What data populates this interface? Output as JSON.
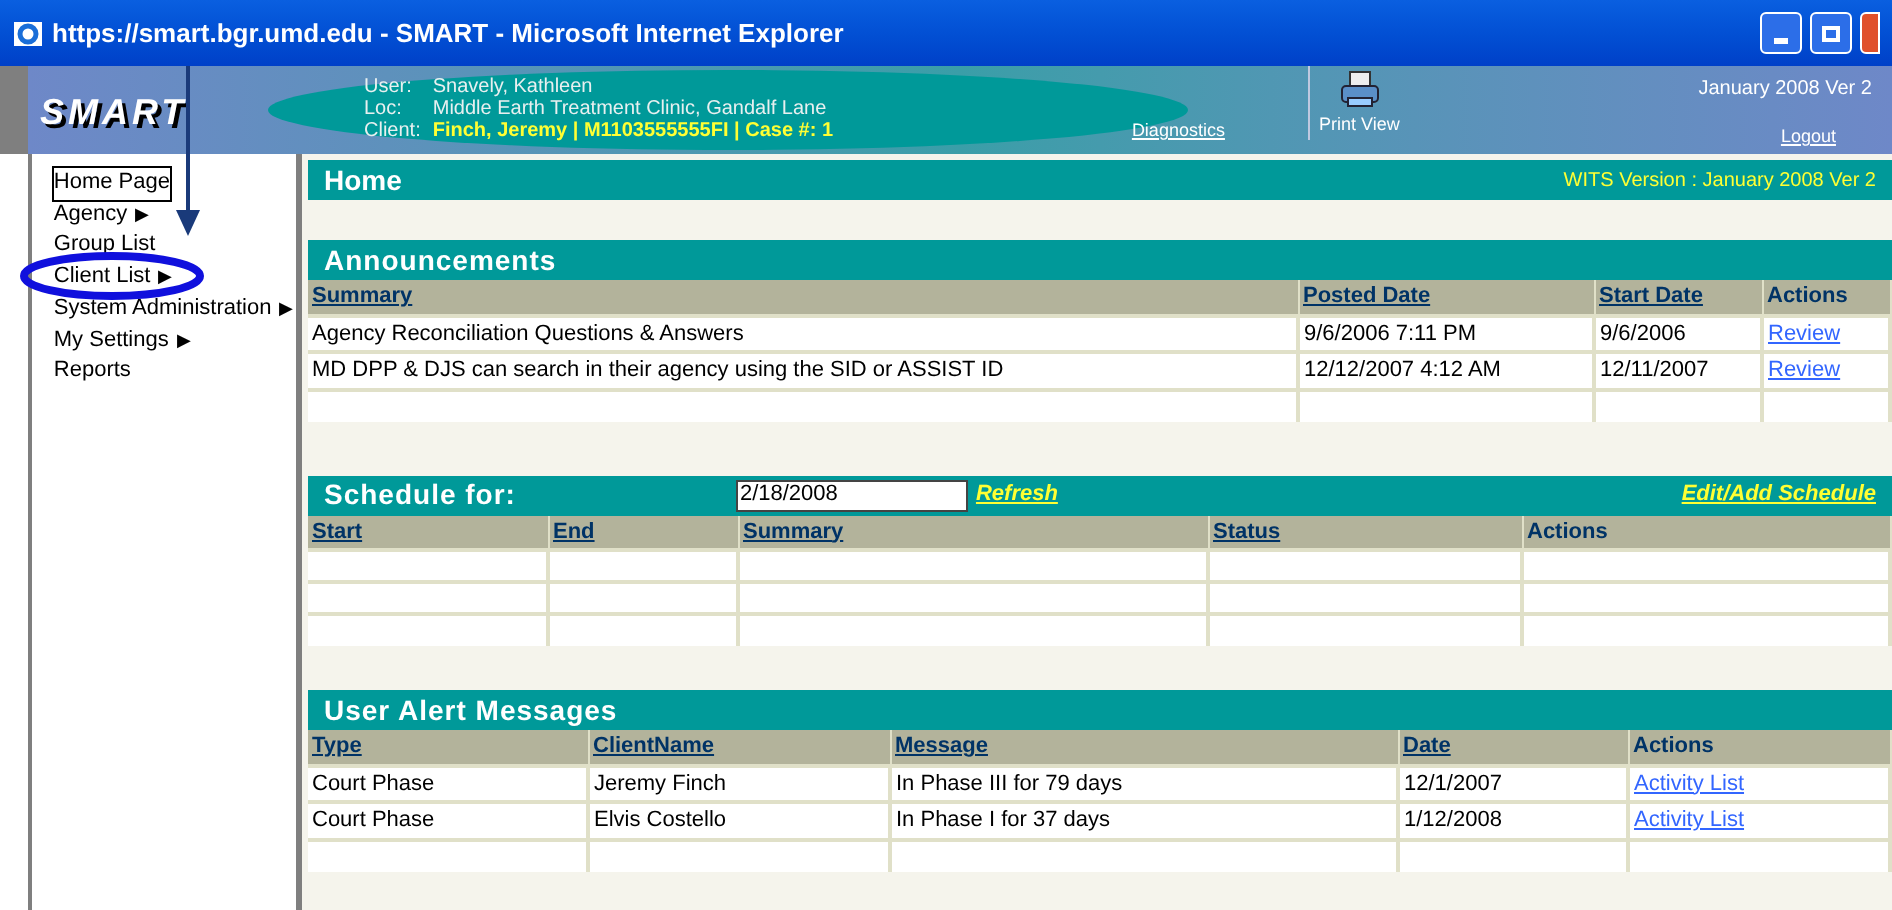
{
  "window": {
    "title": "https://smart.bgr.umd.edu - SMART - Microsoft Internet Explorer"
  },
  "header": {
    "logo": "SMART",
    "user_label": "User:",
    "user": "Snavely, Kathleen",
    "loc_label": "Loc:",
    "loc": "Middle Earth Treatment Clinic, Gandalf Lane",
    "client_label": "Client:",
    "client": "Finch, Jeremy | M1103555555FI | Case #: 1",
    "diagnostics": "Diagnostics",
    "print_view": "Print View",
    "version": "January 2008 Ver 2",
    "logout": "Logout"
  },
  "sidebar": {
    "items": [
      {
        "label": "Home Page",
        "selected": true
      },
      {
        "label": "Agency",
        "arrow": "▶",
        "selected": false
      },
      {
        "label": "Group List",
        "selected": false
      },
      {
        "label": "Client List",
        "arrow": "▶",
        "selected": false
      },
      {
        "label": "System Administration",
        "arrow": "▶",
        "selected": false
      },
      {
        "label": "My Settings",
        "arrow": "▶",
        "selected": false
      },
      {
        "label": "Reports",
        "selected": false
      }
    ]
  },
  "home": {
    "title": "Home",
    "wits_version": "WITS Version : January 2008 Ver 2"
  },
  "announcements": {
    "title": "Announcements",
    "columns": [
      "Summary",
      "Posted Date",
      "Start Date",
      "Actions"
    ],
    "rows": [
      [
        "Agency Reconciliation Questions & Answers",
        "9/6/2006 7:11 PM",
        "9/6/2006",
        "Review"
      ],
      [
        "MD DPP & DJS can search in their agency using the SID or ASSIST ID",
        "12/12/2007 4:12 AM",
        "12/11/2007",
        "Review"
      ]
    ]
  },
  "schedule": {
    "title": "Schedule for:",
    "date": "2/18/2008",
    "refresh": "Refresh",
    "edit": "Edit/Add Schedule",
    "columns": [
      "Start",
      "End",
      "Summary",
      "Status",
      "Actions"
    ]
  },
  "alerts": {
    "title": "User Alert Messages",
    "columns": [
      "Type",
      "ClientName",
      "Message",
      "Date",
      "Actions"
    ],
    "rows": [
      [
        "Court Phase",
        "Jeremy Finch",
        "In Phase III for 79 days",
        "12/1/2007",
        "Activity List"
      ],
      [
        "Court Phase",
        "Elvis Costello",
        "In Phase I for 37 days",
        "1/12/2008",
        "Activity List"
      ]
    ]
  }
}
